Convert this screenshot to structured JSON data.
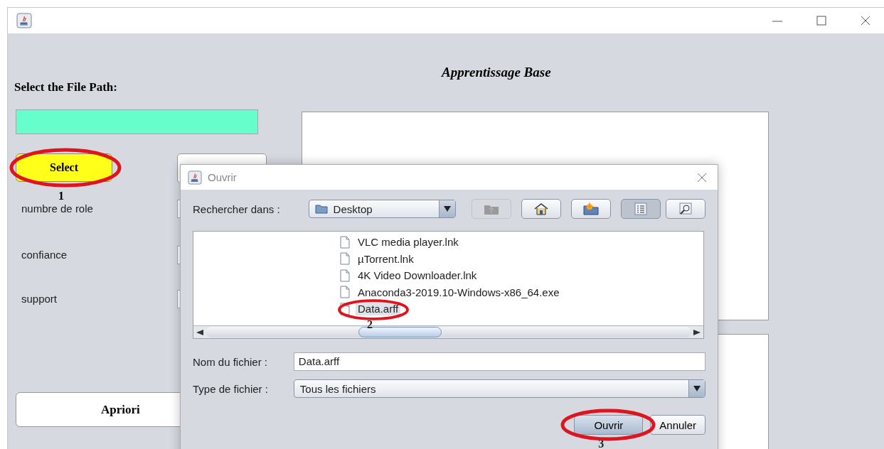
{
  "window": {
    "controls": [
      {
        "kind": "minimize"
      },
      {
        "kind": "maximize"
      },
      {
        "kind": "close"
      }
    ]
  },
  "file_path_label": "Select the File Path:",
  "select_button": {
    "label": "Select",
    "annotation": "1"
  },
  "parameters": [
    {
      "label": "numbre de role"
    },
    {
      "label": "confiance"
    },
    {
      "label": "support"
    }
  ],
  "apriori_button": "Apriori",
  "title": "Apprentissage Base",
  "dialog": {
    "title": "Ouvrir",
    "look_in_label": "Rechercher dans :",
    "look_in_value": "Desktop",
    "toolbar": [
      {
        "kind": "up",
        "disabled": true,
        "selected": false
      },
      {
        "kind": "home",
        "disabled": false,
        "selected": false
      },
      {
        "kind": "new-folder",
        "disabled": false,
        "selected": false
      },
      {
        "kind": "list",
        "disabled": false,
        "selected": true
      },
      {
        "kind": "details",
        "disabled": false,
        "selected": false
      }
    ],
    "files": [
      {
        "name": "VLC media player.lnk",
        "selected": false
      },
      {
        "name": "µTorrent.lnk",
        "selected": false
      },
      {
        "name": "4K Video Downloader.lnk",
        "selected": false
      },
      {
        "name": "Anaconda3-2019.10-Windows-x86_64.exe",
        "selected": false
      },
      {
        "name": "Data.arff",
        "selected": true,
        "annotation": "2"
      }
    ],
    "file_name_label": "Nom du fichier :",
    "file_name_value": "Data.arff",
    "file_type_label": "Type de fichier :",
    "file_type_value": "Tous les fichiers",
    "buttons": [
      {
        "label": "Ouvrir",
        "focused": true,
        "annotation": "3"
      },
      {
        "label": "Annuler",
        "focused": false
      }
    ]
  }
}
